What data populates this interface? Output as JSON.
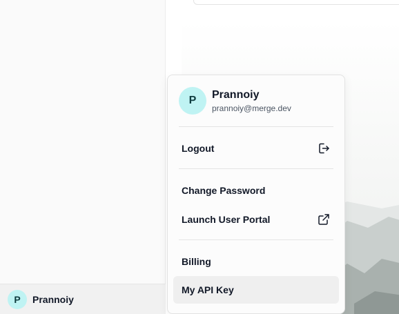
{
  "sidebar": {
    "footer": {
      "avatar_initial": "P",
      "name": "Prannoiy"
    }
  },
  "user_menu": {
    "avatar_initial": "P",
    "name": "Prannoiy",
    "email": "prannoiy@merge.dev",
    "items": [
      {
        "label": "Logout",
        "icon": "logout-icon"
      },
      {
        "label": "Change Password",
        "icon": null
      },
      {
        "label": "Launch User Portal",
        "icon": "external-link-icon"
      },
      {
        "label": "Billing",
        "icon": null
      },
      {
        "label": "My API Key",
        "icon": null
      }
    ]
  },
  "colors": {
    "avatar_bg": "#bff3f3",
    "active_item_bg": "#efefef",
    "sidebar_bg": "#fafafa"
  }
}
